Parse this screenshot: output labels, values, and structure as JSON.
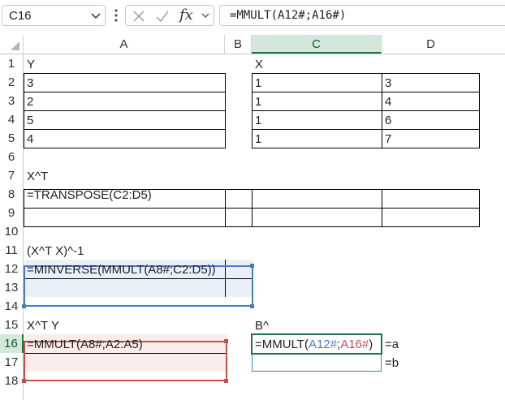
{
  "formula_bar": {
    "name_box": "C16",
    "fx_label": "fx",
    "formula": "=MMULT(A12#;A16#)"
  },
  "columns": [
    "A",
    "B",
    "C",
    "D"
  ],
  "rows": [
    "1",
    "2",
    "3",
    "4",
    "5",
    "6",
    "7",
    "8",
    "9",
    "10",
    "11",
    "12",
    "13",
    "14",
    "15",
    "16",
    "17",
    "18"
  ],
  "cells": {
    "A1": "Y",
    "A2": "3",
    "A3": "2",
    "A4": "5",
    "A5": "4",
    "C1": "X",
    "C2": "1",
    "C3": "1",
    "C4": "1",
    "C5": "1",
    "D2": "3",
    "D3": "4",
    "D4": "6",
    "D5": "7",
    "A7": "X^T",
    "A8": "=TRANSPOSE(C2:D5)",
    "A11": "(X^T X)^-1",
    "A12": "=MINVERSE(MMULT(A8#;C2:D5))",
    "A15": "X^T Y",
    "A16": "=MMULT(A8#;A2:A5)",
    "C15": "B^",
    "E16": "=a",
    "E17": "=b"
  },
  "c16_parts": {
    "prefix": "=MMULT(",
    "ref1": "A12#",
    "sep": ";",
    "ref2": "A16#",
    "suffix": ")"
  },
  "colors": {
    "selection": "#1e7145",
    "ref_blue": "#4a7bbf",
    "ref_red": "#c0504d",
    "blue_fill": "#eaf0f8",
    "red_fill": "#fbecec"
  }
}
